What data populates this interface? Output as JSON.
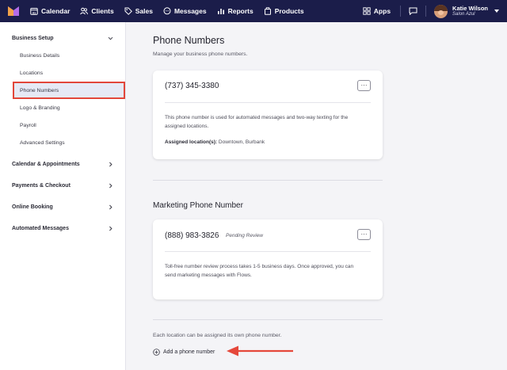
{
  "colors": {
    "nav_bg": "#1b1d4a",
    "highlight": "#e2463a",
    "arrow": "#e5483b"
  },
  "nav": {
    "items": [
      {
        "label": "Calendar",
        "icon": "calendar-icon"
      },
      {
        "label": "Clients",
        "icon": "clients-icon"
      },
      {
        "label": "Sales",
        "icon": "tag-icon"
      },
      {
        "label": "Messages",
        "icon": "messages-icon"
      },
      {
        "label": "Reports",
        "icon": "reports-icon"
      },
      {
        "label": "Products",
        "icon": "products-icon"
      }
    ],
    "apps_label": "Apps",
    "user_name": "Katie Wilson",
    "user_org": "Salon Azul"
  },
  "sidebar": {
    "business_setup": "Business Setup",
    "sub_items": [
      "Business Details",
      "Locations",
      "Phone Numbers",
      "Logo & Branding",
      "Payroll",
      "Advanced Settings"
    ],
    "active_item": "Phone Numbers",
    "sections": [
      "Calendar & Appointments",
      "Payments & Checkout",
      "Online Booking",
      "Automated Messages"
    ]
  },
  "main": {
    "title": "Phone Numbers",
    "subtitle": "Manage your business phone numbers.",
    "card1": {
      "phone": "(737) 345-3380",
      "more": "···",
      "description": "This phone number is used for automated messages and two-way texting for the assigned locations.",
      "assigned_label": "Assigned location(s):",
      "assigned_value": "Downtown, Burbank"
    },
    "marketing_title": "Marketing Phone Number",
    "card2": {
      "phone": "(888) 983-3826",
      "badge": "Pending Review",
      "more": "···",
      "description": "Toll-free number review process takes 1-5 business days. Once approved, you can send marketing messages with Flows."
    },
    "footer_note": "Each location can be assigned its own phone number.",
    "add_label": "Add a phone number"
  }
}
